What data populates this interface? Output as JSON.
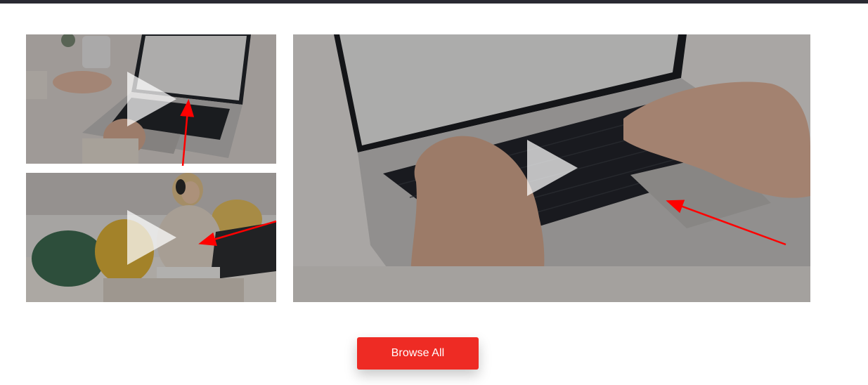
{
  "videos": [
    {
      "id": "video-1",
      "thumbnail": "laptop-desk-top-view",
      "icon": "play-icon"
    },
    {
      "id": "video-2",
      "thumbnail": "woman-laptop-couch",
      "icon": "play-icon"
    },
    {
      "id": "video-3",
      "thumbnail": "hands-typing-laptop",
      "icon": "play-icon"
    }
  ],
  "actions": {
    "browse_all_label": "Browse All"
  },
  "colors": {
    "accent": "#ee2b24",
    "topbar": "#2a2a33",
    "annotation_arrow": "#ff0000"
  }
}
